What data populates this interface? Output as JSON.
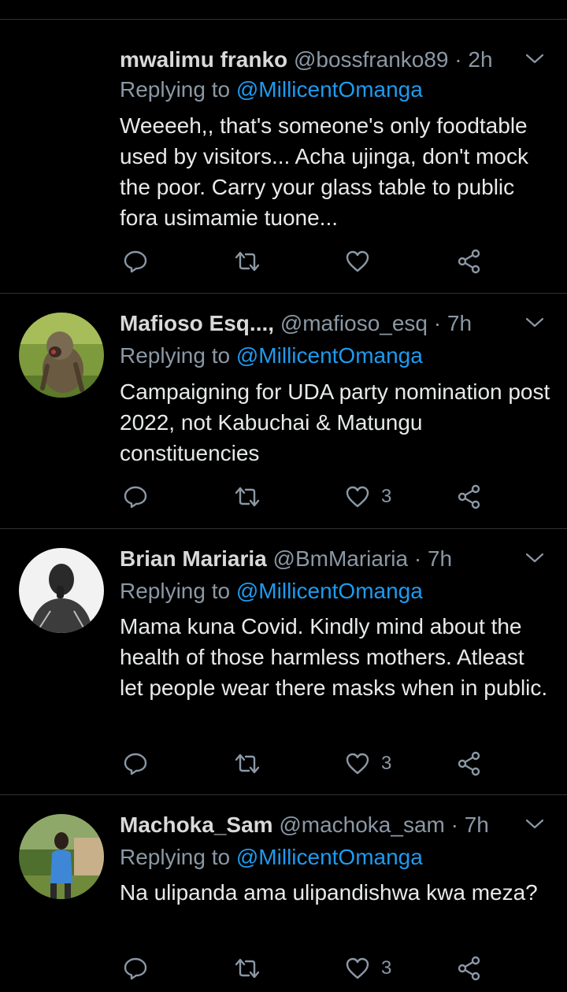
{
  "tweets": [
    {
      "name": "mwalimu franko",
      "handle": "@bossfranko89",
      "separator": "·",
      "time": "2h",
      "reply_prefix": "Replying to",
      "reply_to": "@MillicentOmanga",
      "text": "Weeeeh,, that's someone's only foodtable used by visitors... Acha ujinga, don't mock the poor. Carry your glass table to public fora usimamie tuone...",
      "likes": ""
    },
    {
      "name": "Mafioso Esq...,",
      "handle": "@mafioso_esq",
      "separator": "·",
      "time": "7h",
      "reply_prefix": "Replying to",
      "reply_to": "@MillicentOmanga",
      "text": "Campaigning for UDA party nomination post 2022, not Kabuchai & Matungu constituencies",
      "likes": "3"
    },
    {
      "name": "Brian Mariaria",
      "handle": "@BmMariaria",
      "separator": "·",
      "time": "7h",
      "reply_prefix": "Replying to",
      "reply_to": "@MillicentOmanga",
      "text": "Mama kuna Covid. Kindly mind about the health of those harmless mothers. Atleast let people wear there masks when in public.",
      "likes": "3"
    },
    {
      "name": "Machoka_Sam",
      "handle": "@machoka_sam",
      "separator": "·",
      "time": "7h",
      "reply_prefix": "Replying to",
      "reply_to": "@MillicentOmanga",
      "text": "Na ulipanda ama ulipandishwa kwa meza?",
      "likes": "3"
    }
  ],
  "icons": {
    "reply": "reply-icon",
    "retweet": "retweet-icon",
    "like": "like-icon",
    "share": "share-icon",
    "more": "chevron-down-icon"
  },
  "colors": {
    "background": "#000000",
    "name": "#d9d9d9",
    "secondary": "#8b98a5",
    "mention": "#1d9bf0",
    "divider": "#2f3336"
  }
}
